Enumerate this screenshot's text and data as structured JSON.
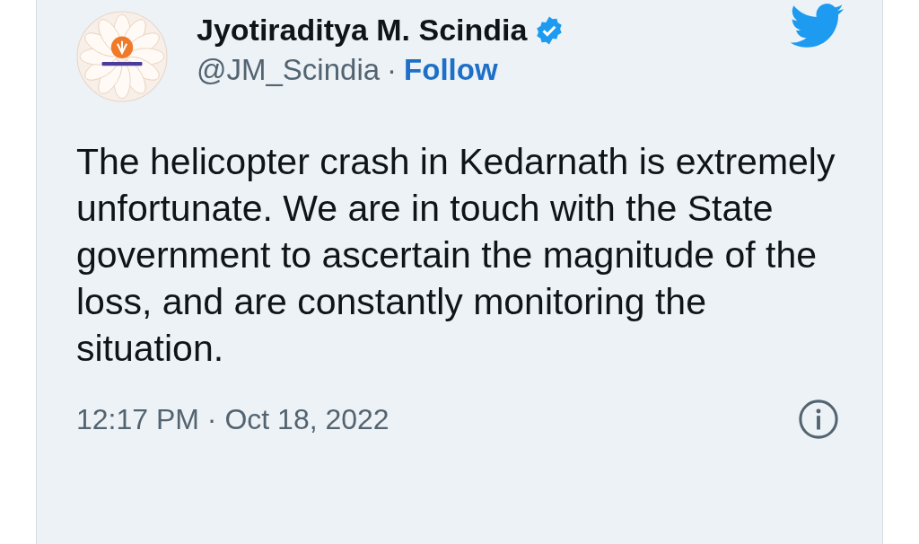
{
  "author": {
    "name": "Jyotiraditya M. Scindia",
    "verified": true,
    "handle": "@JM_Scindia",
    "separator": "·",
    "follow": "Follow"
  },
  "tweet": {
    "text": "The helicopter crash in Kedarnath is extremely unfortunate. We are in touch with the State government to ascertain the magnitude of the loss, and are constantly monitoring the situation."
  },
  "footer": {
    "timestamp": "12:17 PM · Oct 18, 2022"
  }
}
